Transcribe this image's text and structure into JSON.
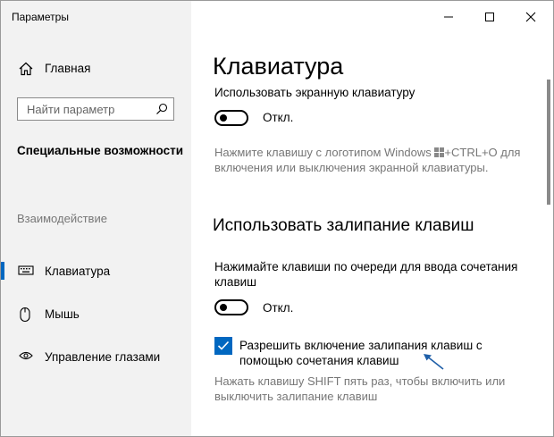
{
  "window": {
    "title": "Параметры",
    "caption_icons": [
      "minimize-icon",
      "maximize-icon",
      "close-icon"
    ]
  },
  "sidebar": {
    "home": {
      "icon": "home-icon",
      "label": "Главная"
    },
    "search": {
      "placeholder": "Найти параметр",
      "value": "",
      "icon": "search-icon"
    },
    "section_header": "Специальные возможности",
    "group_label": "Взаимодействие",
    "items": [
      {
        "icon": "keyboard-icon",
        "label": "Клавиатура",
        "active": true
      },
      {
        "icon": "mouse-icon",
        "label": "Мышь",
        "active": false
      },
      {
        "icon": "eye-control-icon",
        "label": "Управление глазами",
        "active": false
      }
    ]
  },
  "main": {
    "title": "Клавиатура",
    "onscreen_keyboard": {
      "label": "Использовать экранную клавиатуру",
      "toggle_state": "Откл.",
      "toggle_on": false,
      "hint_before": "Нажмите клавишу с логотипом Windows",
      "hint_icon": "windows-logo-icon",
      "hint_after": "+CTRL+O для",
      "hint_line2": "включения или выключения экранной клавиатуры."
    },
    "sticky_keys": {
      "heading": "Использовать залипание клавиш",
      "label_line1": "Нажимайте клавиши по очереди для ввода сочетания",
      "label_line2": "клавиш",
      "toggle_state": "Откл.",
      "toggle_on": false,
      "checkbox_checked": true,
      "checkbox_label_line1": "Разрешить включение залипания клавиш с",
      "checkbox_label_line2": "помощью сочетания клавиш",
      "hint_line1": "Нажать клавишу SHIFT пять раз, чтобы включить или",
      "hint_line2": "выключить залипание клавиш"
    }
  },
  "colors": {
    "accent": "#0067c0",
    "sidebar_bg": "#f2f2f2",
    "hint_text": "#777777"
  }
}
